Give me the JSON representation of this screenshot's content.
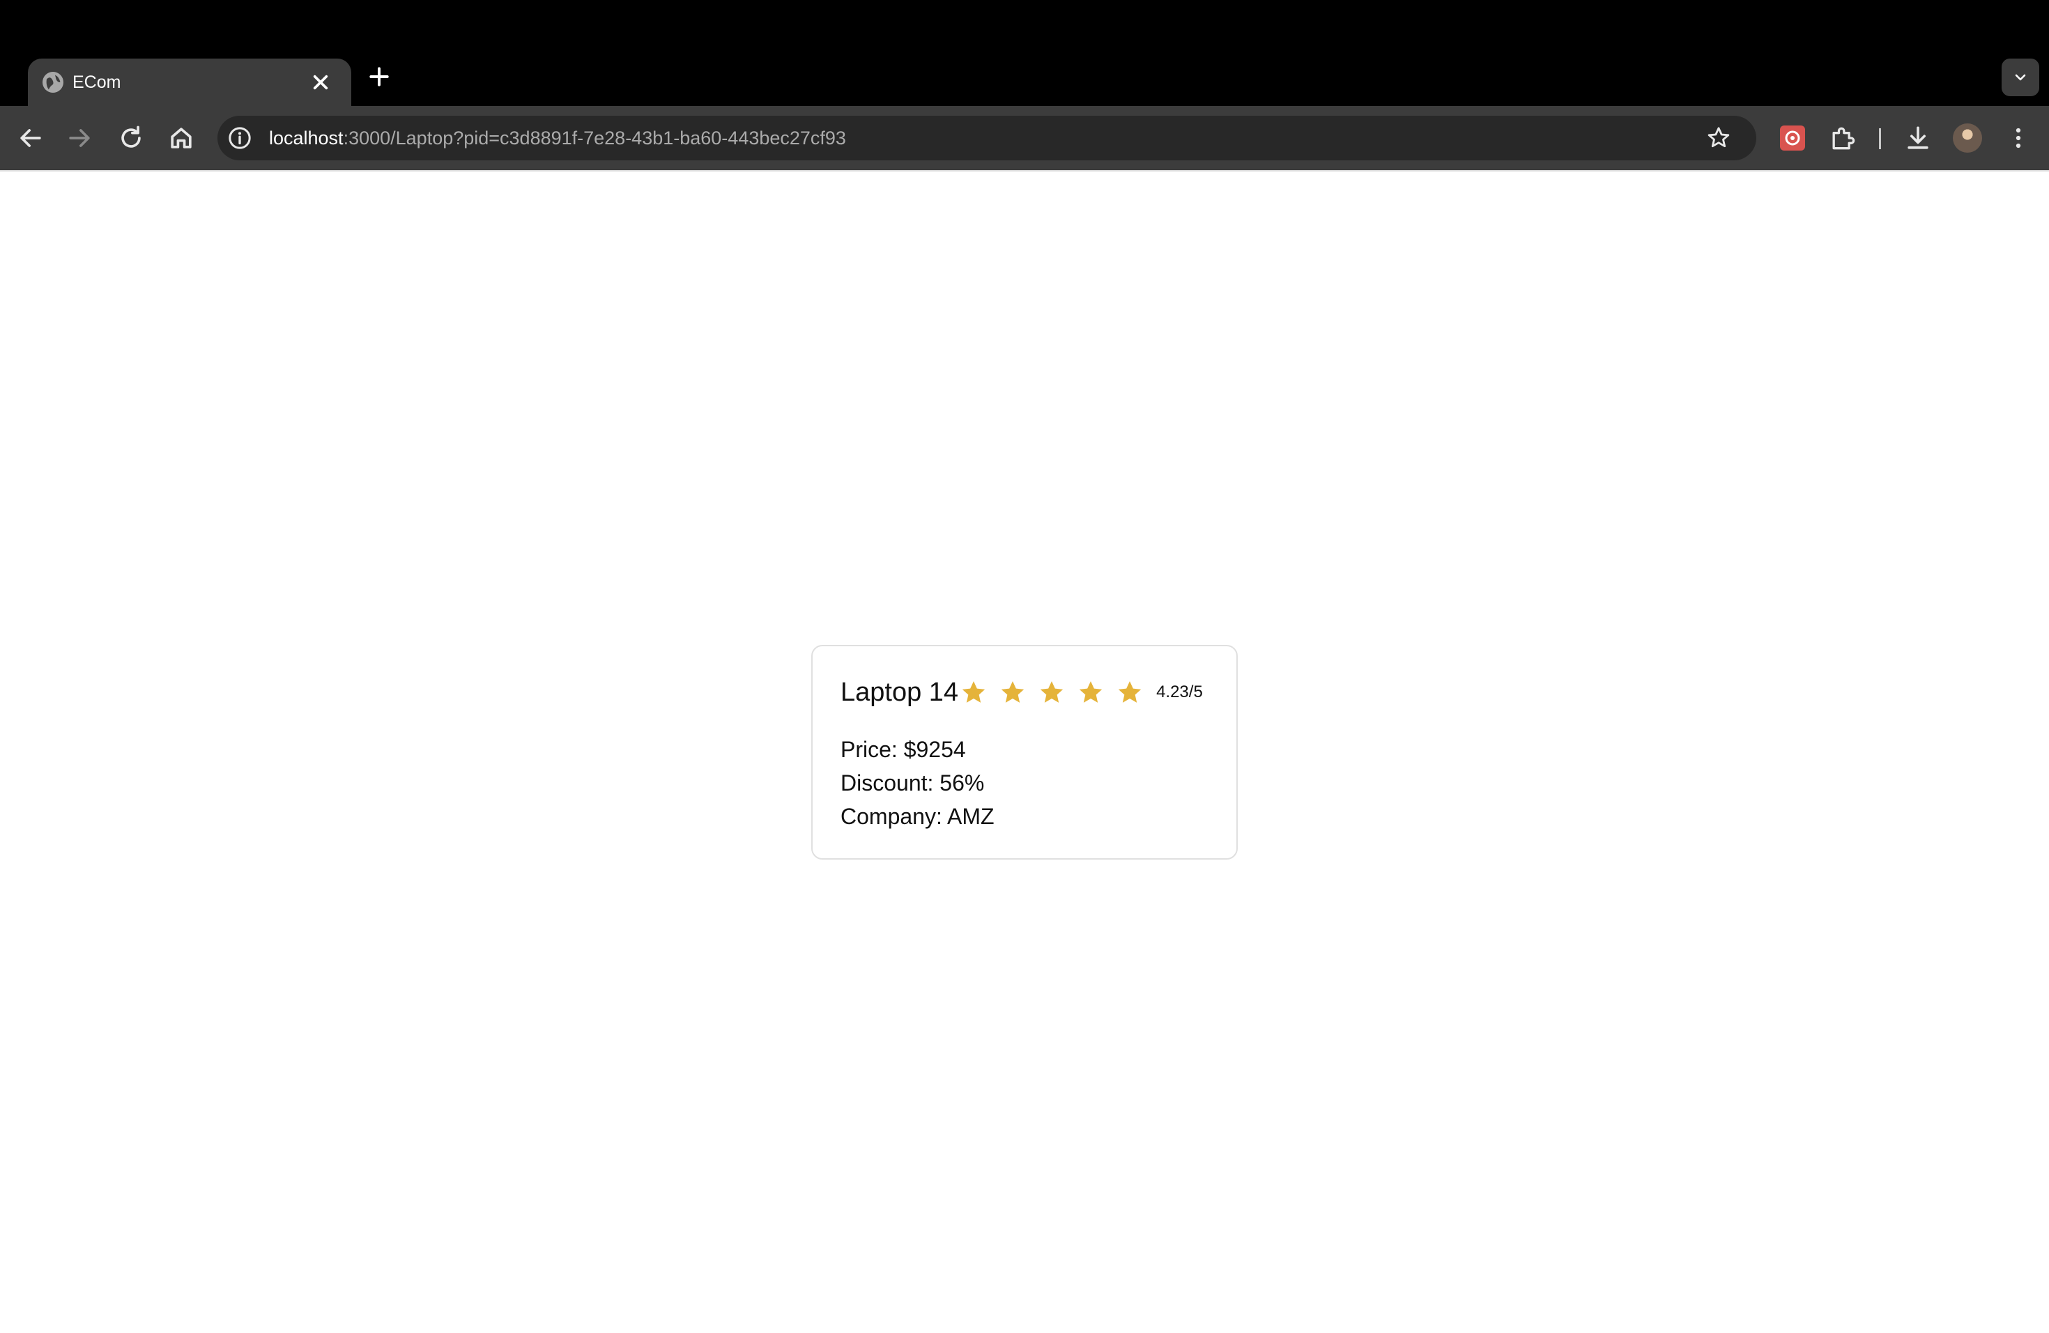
{
  "browser": {
    "tab": {
      "title": "ECom"
    },
    "address_bar": {
      "host": "localhost",
      "path": ":3000/Laptop?pid=c3d8891f-7e28-43b1-ba60-443bec27cf93"
    },
    "icons": {
      "tab_favicon": "globe-icon",
      "tab_close": "close-icon",
      "new_tab": "plus-icon",
      "tab_search": "chevron-down-icon",
      "back": "arrow-left-icon",
      "forward": "arrow-right-icon",
      "reload": "reload-icon",
      "home": "home-icon",
      "site_info": "info-icon",
      "bookmark": "star-outline-icon",
      "extension_app": "app-extension-icon",
      "extensions": "puzzle-icon",
      "downloads": "download-icon",
      "profile": "avatar",
      "menu": "kebab-menu-icon"
    }
  },
  "product": {
    "name": "Laptop 14",
    "rating": {
      "value": 4.23,
      "max": 5,
      "label": "4.23/5",
      "stars_shown": 5,
      "star_color": "#E5B33A"
    },
    "price_label": "Price: $9254",
    "discount_label": "Discount: 56%",
    "company_label": "Company: AMZ"
  },
  "colors": {
    "tabstrip_bg": "#000000",
    "toolbar_bg": "#3C3C3C",
    "omnibox_bg": "#282828",
    "page_bg": "#FFFFFF",
    "card_border": "#E0E0E0"
  }
}
